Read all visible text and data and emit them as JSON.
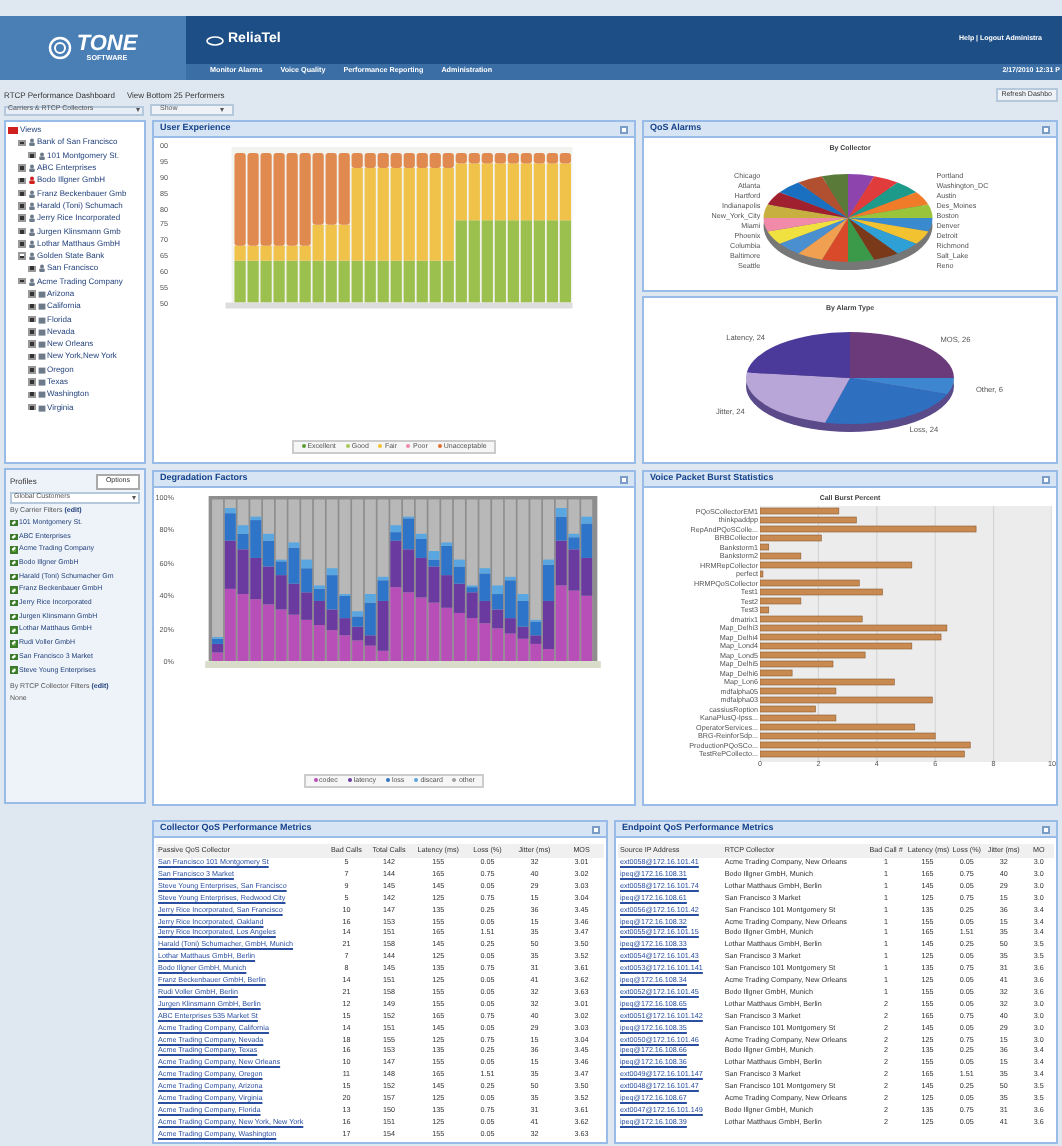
{
  "header": {
    "logo": "TONE",
    "logo_sub": "SOFTWARE",
    "product": "ReliaTel",
    "nav": [
      "Monitor Alarms",
      "Voice Quality",
      "Performance Reporting",
      "Administration"
    ],
    "user_links": "Help | Logout Administra",
    "datetime": "2/17/2010 12:31 P"
  },
  "toolbar": {
    "title": "RTCP Performance Dashboard",
    "view": "View Bottom 25 Performers",
    "refresh": "Refresh Dashbo",
    "scope_select": "Carriers & RTCP Collectors",
    "show_select": "Show"
  },
  "sidebar": {
    "tree": [
      {
        "label": "Views",
        "kind": "views",
        "alarm": true,
        "children": [
          {
            "label": "Bank of San Francisco",
            "kind": "carrier",
            "alarm": false,
            "expanded": true,
            "children": [
              {
                "label": "101 Montgomery St.",
                "kind": "carrier",
                "alarm": false,
                "expanded": false
              }
            ]
          },
          {
            "label": "ABC Enterprises",
            "kind": "carrier",
            "alarm": false,
            "expanded": false
          },
          {
            "label": "Bodo Illgner GmbH",
            "kind": "carrier",
            "alarm": true,
            "expanded": false
          },
          {
            "label": "Franz Beckenbauer Gmb",
            "kind": "carrier",
            "alarm": false,
            "expanded": false
          },
          {
            "label": "Harald (Toni) Schumach",
            "kind": "carrier",
            "alarm": false,
            "expanded": false
          },
          {
            "label": "Jerry Rice Incorporated",
            "kind": "carrier",
            "alarm": false,
            "expanded": false
          },
          {
            "label": "Jurgen Klinsmann Gmb",
            "kind": "carrier",
            "alarm": false,
            "expanded": false
          },
          {
            "label": "Lothar Matthaus GmbH",
            "kind": "carrier",
            "alarm": false,
            "expanded": false
          },
          {
            "label": "Golden State Bank",
            "kind": "carrier",
            "alarm": false,
            "expanded": true,
            "children": [
              {
                "label": "San Francisco",
                "kind": "carrier",
                "alarm": false,
                "expanded": false
              }
            ]
          },
          {
            "label": "Acme Trading Company",
            "kind": "carrier",
            "alarm": false,
            "expanded": true,
            "children": [
              {
                "label": "Arizona",
                "kind": "site",
                "alarm": false,
                "expanded": false
              },
              {
                "label": "California",
                "kind": "site",
                "alarm": false,
                "expanded": false
              },
              {
                "label": "Florida",
                "kind": "site",
                "alarm": false,
                "expanded": false
              },
              {
                "label": "Nevada",
                "kind": "site",
                "alarm": false,
                "expanded": false
              },
              {
                "label": "New Orleans",
                "kind": "site",
                "alarm": false,
                "expanded": false
              },
              {
                "label": "New York,New York",
                "kind": "site",
                "alarm": false,
                "expanded": false
              },
              {
                "label": "Oregon",
                "kind": "site",
                "alarm": false,
                "expanded": false
              },
              {
                "label": "Texas",
                "kind": "site",
                "alarm": false,
                "expanded": false
              },
              {
                "label": "Washington",
                "kind": "site",
                "alarm": false,
                "expanded": false
              },
              {
                "label": "Virginia",
                "kind": "site",
                "alarm": false,
                "expanded": false
              }
            ]
          }
        ]
      }
    ],
    "profiles": {
      "title": "Profiles",
      "options_button": "Options",
      "select": "Global Customers",
      "carrier_filter_label": "By Carrier Filters",
      "carrier_edit": "(edit)",
      "carriers": [
        {
          "label": "101 Montgomery St.",
          "checked": true
        },
        {
          "label": "ABC Enterprises",
          "checked": true
        },
        {
          "label": "Acme Trading Company",
          "checked": true
        },
        {
          "label": "Bodo Illgner GmbH",
          "checked": true
        },
        {
          "label": "Harald (Toni) Schumacher Gm",
          "checked": true
        },
        {
          "label": "Franz Beckenbauer GmbH",
          "checked": true
        },
        {
          "label": "Jerry Rice Incorporated",
          "checked": true
        },
        {
          "label": "Jurgen Klinsmann GmbH",
          "checked": true
        },
        {
          "label": "Lothar Matthaus GmbH",
          "checked": true
        },
        {
          "label": "Rudi Voller GmbH",
          "checked": true
        },
        {
          "label": "San Francisco 3 Market",
          "checked": true
        },
        {
          "label": "Steve Young Enterprises",
          "checked": true
        }
      ],
      "collector_filter_label": "By RTCP Collector Filters",
      "collector_edit": "(edit)",
      "collector_filters": "None"
    }
  },
  "user_experience": {
    "title": "User Experience",
    "yticks": [
      "00",
      "95",
      "90",
      "85",
      "80",
      "75",
      "70",
      "65",
      "60",
      "55",
      "50"
    ],
    "legend": [
      {
        "label": "Excellent",
        "color": "#5a9a32"
      },
      {
        "label": "Good",
        "color": "#a6c85a"
      },
      {
        "label": "Fair",
        "color": "#f2c230"
      },
      {
        "label": "Poor",
        "color": "#f08aa8"
      },
      {
        "label": "Unacceptable",
        "color": "#e0702e"
      }
    ]
  },
  "qos_alarms": {
    "title": "QoS Alarms",
    "by_collector": {
      "title": "By Collector",
      "labels_left": [
        "Chicago",
        "Atlanta",
        "Hartford",
        "Indianapolis",
        "New_York_City",
        "Miami",
        "Phoenix",
        "Columbia",
        "Baltimore",
        "Seattle"
      ],
      "labels_right": [
        "Portland",
        "Washington_DC",
        "Austin",
        "Des_Moines",
        "Boston",
        "Denver",
        "Detroit",
        "Richmond",
        "Salt_Lake",
        "Reno"
      ]
    },
    "by_type": {
      "chart_data": {
        "type": "pie",
        "title": "By Alarm Type",
        "categories": [
          "MOS",
          "Other",
          "Loss",
          "Jitter",
          "Latency"
        ],
        "values": [
          26,
          6,
          24,
          24,
          24
        ],
        "colors": [
          "#6b3a7a",
          "#3f86d0",
          "#2e6fc0",
          "#b9a6d8",
          "#4b3a9a"
        ],
        "data_labels": true
      },
      "label_separator": ", "
    }
  },
  "degradation": {
    "title": "Degradation Factors",
    "yticks": [
      "100%",
      "80%",
      "60%",
      "40%",
      "20%",
      "0%"
    ],
    "legend": [
      {
        "label": "codec",
        "color": "#b84fb8"
      },
      {
        "label": "latency",
        "color": "#6a3aa0"
      },
      {
        "label": "loss",
        "color": "#2e74c8"
      },
      {
        "label": "discard",
        "color": "#5aa6e0"
      },
      {
        "label": "other",
        "color": "#a0a0a0"
      }
    ]
  },
  "burst": {
    "title": "Voice Packet Burst Statistics",
    "chart_data": {
      "type": "bar",
      "orientation": "horizontal",
      "title": "Call Burst Percent",
      "categories": [
        "PQoSCollectorEM1",
        "thinkpaddpp",
        "RepAndPQoSColle...",
        "BRBCollector",
        "Bankstorm1",
        "Bankstorm2",
        "HRMRepCollector",
        "perfect",
        "HRMPQoSCollector",
        "Test1",
        "Test2",
        "Test3",
        "dmatrix1",
        "Map_Delhi3",
        "Map_Delhi4",
        "Map_Lond4",
        "Map_Lond5",
        "Map_Delhi5",
        "Map_Delhi6",
        "Map_Lon6",
        "mdfalpha05",
        "mdfalpha03",
        "cassiusRoption",
        "KanaPlusQ-Ipss...",
        "OperatorServices...",
        "BRG-ReinforSdp...",
        "ProductionPQoSCo...",
        "TestRePCollecto..."
      ],
      "series": [
        {
          "color": "#c88a50",
          "values": [
            2.7,
            3.3,
            7.4,
            2.1,
            0.3,
            1.4,
            5.2,
            0.1,
            3.4,
            4.2,
            1.4,
            0.3,
            3.5,
            6.4,
            6.2,
            5.2,
            3.6,
            2.5,
            1.1,
            4.6,
            2.6,
            5.9,
            1.9,
            2.6,
            5.3,
            6.0,
            7.2,
            7.0
          ]
        }
      ],
      "xlim": [
        0,
        10
      ],
      "xticks": [
        0,
        2,
        4,
        6,
        8,
        10
      ],
      "grid": true
    }
  },
  "collector_table": {
    "title": "Collector QoS Performance Metrics",
    "columns": [
      "Passive QoS Collector",
      "Bad Calls",
      "Total Calls",
      "Latency (ms)",
      "Loss (%)",
      "Jitter (ms)",
      "MOS"
    ],
    "rows": [
      [
        "San Francisco 101 Montgomery St",
        "5",
        "142",
        "155",
        "0.05",
        "32",
        "3.01"
      ],
      [
        "San Francisco 3 Market",
        "7",
        "144",
        "165",
        "0.75",
        "40",
        "3.02"
      ],
      [
        "Steve Young Enterprises, San Francisco",
        "9",
        "145",
        "145",
        "0.05",
        "29",
        "3.03"
      ],
      [
        "Steve Young Enterprises, Redwood City",
        "5",
        "142",
        "125",
        "0.75",
        "15",
        "3.04"
      ],
      [
        "Jerry Rice Incorporated, San Francisco",
        "10",
        "147",
        "135",
        "0.25",
        "36",
        "3.45"
      ],
      [
        "Jerry Rice Incorporated, Oakland",
        "16",
        "153",
        "155",
        "0.05",
        "15",
        "3.46"
      ],
      [
        "Jerry Rice Incorporated, Los Angeles",
        "14",
        "151",
        "165",
        "1.51",
        "35",
        "3.47"
      ],
      [
        "Harald (Toni) Schumacher, GmbH, Munich",
        "21",
        "158",
        "145",
        "0.25",
        "50",
        "3.50"
      ],
      [
        "Lothar Matthaus GmbH, Berlin",
        "7",
        "144",
        "125",
        "0.05",
        "35",
        "3.52"
      ],
      [
        "Bodo Illgner GmbH, Munich",
        "8",
        "145",
        "135",
        "0.75",
        "31",
        "3.61"
      ],
      [
        "Franz Beckenbauer GmbH, Berlin",
        "14",
        "151",
        "125",
        "0.05",
        "41",
        "3.62"
      ],
      [
        "Rudi Voller GmbH, Berlin",
        "21",
        "158",
        "155",
        "0.05",
        "32",
        "3.63"
      ],
      [
        "Jurgen Klinsmann GmbH, Berlin",
        "12",
        "149",
        "155",
        "0.05",
        "32",
        "3.01"
      ],
      [
        "ABC Enterprises 535 Market St",
        "15",
        "152",
        "165",
        "0.75",
        "40",
        "3.02"
      ],
      [
        "Acme Trading Company, California",
        "14",
        "151",
        "145",
        "0.05",
        "29",
        "3.03"
      ],
      [
        "Acme Trading Company, Nevada",
        "18",
        "155",
        "125",
        "0.75",
        "15",
        "3.04"
      ],
      [
        "Acme Trading Company, Texas",
        "16",
        "153",
        "135",
        "0.25",
        "36",
        "3.45"
      ],
      [
        "Acme Trading Company, New Orleans",
        "10",
        "147",
        "155",
        "0.05",
        "15",
        "3.46"
      ],
      [
        "Acme Trading Company, Oregon",
        "11",
        "148",
        "165",
        "1.51",
        "35",
        "3.47"
      ],
      [
        "Acme Trading Company, Arizona",
        "15",
        "152",
        "145",
        "0.25",
        "50",
        "3.50"
      ],
      [
        "Acme Trading Company, Virginia",
        "20",
        "157",
        "125",
        "0.05",
        "35",
        "3.52"
      ],
      [
        "Acme Trading Company, Florida",
        "13",
        "150",
        "135",
        "0.75",
        "31",
        "3.61"
      ],
      [
        "Acme Trading Company, New York, New York",
        "16",
        "151",
        "125",
        "0.05",
        "41",
        "3.62"
      ],
      [
        "Acme Trading Company, Washington",
        "17",
        "154",
        "155",
        "0.05",
        "32",
        "3.63"
      ]
    ]
  },
  "endpoint_table": {
    "title": "Endpoint QoS Performance Metrics",
    "columns": [
      "Source IP Address",
      "RTCP Collector",
      "Bad Call #",
      "Latency (ms)",
      "Loss (%)",
      "Jitter (ms)",
      "MO"
    ],
    "rows": [
      [
        "ext0058@172.16.101.41",
        "Acme Trading Company, New Orleans",
        "1",
        "155",
        "0.05",
        "32",
        "3.0"
      ],
      [
        "ipeq@172.16.108.31",
        "Bodo Illgner GmbH, Munich",
        "1",
        "165",
        "0.75",
        "40",
        "3.0"
      ],
      [
        "ext0058@172.16.101.74",
        "Lothar Matthaus GmbH, Berlin",
        "1",
        "145",
        "0.05",
        "29",
        "3.0"
      ],
      [
        "ipeq@172.16.108.61",
        "San Francisco 3 Market",
        "1",
        "125",
        "0.75",
        "15",
        "3.0"
      ],
      [
        "ext0056@172.16.101.42",
        "San Francisco 101 Montgomery St",
        "1",
        "135",
        "0.25",
        "36",
        "3.4"
      ],
      [
        "ipeq@172.16.108.32",
        "Acme Trading Company, New Orleans",
        "1",
        "155",
        "0.05",
        "15",
        "3.4"
      ],
      [
        "ext0055@172.16.101.15",
        "Bodo Illgner GmbH, Munich",
        "1",
        "165",
        "1.51",
        "35",
        "3.4"
      ],
      [
        "ipeq@172.16.108.33",
        "Lothar Matthaus GmbH, Berlin",
        "1",
        "145",
        "0.25",
        "50",
        "3.5"
      ],
      [
        "ext0054@172.16.101.43",
        "San Francisco 3 Market",
        "1",
        "125",
        "0.05",
        "35",
        "3.5"
      ],
      [
        "ext0053@172.16.101.141",
        "San Francisco 101 Montgomery St",
        "1",
        "135",
        "0.75",
        "31",
        "3.6"
      ],
      [
        "ipeq@172.16.108.34",
        "Acme Trading Company, New Orleans",
        "1",
        "125",
        "0.05",
        "41",
        "3.6"
      ],
      [
        "ext0052@172.16.101.45",
        "Bodo Illgner GmbH, Munich",
        "1",
        "155",
        "0.05",
        "32",
        "3.6"
      ],
      [
        "ipeq@172.16.108.65",
        "Lothar Matthaus GmbH, Berlin",
        "2",
        "155",
        "0.05",
        "32",
        "3.0"
      ],
      [
        "ext0051@172.16.101.142",
        "San Francisco 3 Market",
        "2",
        "165",
        "0.75",
        "40",
        "3.0"
      ],
      [
        "ipeq@172.16.108.35",
        "San Francisco 101 Montgomery St",
        "2",
        "145",
        "0.05",
        "29",
        "3.0"
      ],
      [
        "ext0050@172.16.101.46",
        "Acme Trading Company, New Orleans",
        "2",
        "125",
        "0.75",
        "15",
        "3.0"
      ],
      [
        "ipeq@172.16.108.66",
        "Bodo Illgner GmbH, Munich",
        "2",
        "135",
        "0.25",
        "36",
        "3.4"
      ],
      [
        "ipeq@172.16.108.36",
        "Lothar Matthaus GmbH, Berlin",
        "2",
        "155",
        "0.05",
        "15",
        "3.4"
      ],
      [
        "ext0049@172.16.101.147",
        "San Francisco 3 Market",
        "2",
        "165",
        "1.51",
        "35",
        "3.4"
      ],
      [
        "ext0048@172.16.101.47",
        "San Francisco 101 Montgomery St",
        "2",
        "145",
        "0.25",
        "50",
        "3.5"
      ],
      [
        "ipeq@172.16.108.67",
        "Acme Trading Company, New Orleans",
        "2",
        "125",
        "0.05",
        "35",
        "3.5"
      ],
      [
        "ext0047@172.16.101.149",
        "Bodo Illgner GmbH, Munich",
        "2",
        "135",
        "0.75",
        "31",
        "3.6"
      ],
      [
        "ipeq@172.16.108.39",
        "Lothar Matthaus GmbH, Berlin",
        "2",
        "125",
        "0.05",
        "41",
        "3.6"
      ]
    ]
  }
}
